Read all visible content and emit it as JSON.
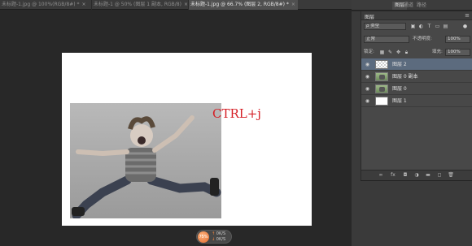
{
  "tabs": [
    {
      "label": "未标题-1.jpg @ 100%(RGB/8#) *",
      "close": "×"
    },
    {
      "label": "未标题-1 @ 50% (图层 1 副本, RGB/8)",
      "close": "×"
    },
    {
      "label": "未标题-1.jpg @ 66.7% (图层 2, RGB/8#) *",
      "close": "×"
    }
  ],
  "panel_tabs": [
    "",
    "通道",
    "路径"
  ],
  "layers_panel": {
    "title": "图层",
    "menu_icon": "≡",
    "filter_kind": "ρ 类型",
    "blend_mode": "正常",
    "opacity_label": "不透明度:",
    "opacity_value": "100%",
    "lock_label": "锁定:",
    "fill_label": "填充:",
    "fill_value": "100%",
    "layers": [
      {
        "name": "图层 2",
        "selected": true,
        "thumb": "checker"
      },
      {
        "name": "图层 0 副本",
        "selected": false,
        "thumb": "photo"
      },
      {
        "name": "图层 0",
        "selected": false,
        "thumb": "photo"
      },
      {
        "name": "图层 1",
        "selected": false,
        "thumb": "white"
      }
    ],
    "eye_icon": "◉",
    "footer_icons": [
      "link-icon",
      "fx-icon",
      "mask-icon",
      "adjustment-icon",
      "folder-icon",
      "new-layer-icon",
      "trash-icon"
    ]
  },
  "canvas": {
    "annotation": "CTRL+j",
    "annotation_color": "#d51e25"
  },
  "badge": {
    "zoom": "75%",
    "line1": "0K/S",
    "line2": "0K/S"
  }
}
